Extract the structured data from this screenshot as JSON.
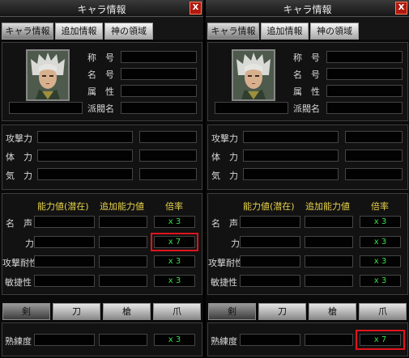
{
  "panels": [
    {
      "title": "キャラ情報",
      "close_label": "X",
      "tabs": [
        "キャラ情報",
        "追加情報",
        "神の領域"
      ],
      "info_labels": [
        "称　号",
        "名　号",
        "属　性",
        "派閥名"
      ],
      "stat_labels": [
        "攻撃力",
        "体　力",
        "気　力"
      ],
      "ability_headers": [
        "能力値(潜在)",
        "追加能力値",
        "倍率"
      ],
      "ability_rows": [
        {
          "label": "名　声",
          "mult": "x 3"
        },
        {
          "label": "力",
          "mult": "x 7"
        },
        {
          "label": "攻撃耐性",
          "mult": "x 3"
        },
        {
          "label": "敏捷性",
          "mult": "x 3"
        }
      ],
      "weapon_tabs": [
        "剣",
        "刀",
        "槍",
        "爪"
      ],
      "mastery_label": "熟練度",
      "mastery_mult": "x 3"
    },
    {
      "title": "キャラ情報",
      "close_label": "X",
      "tabs": [
        "キャラ情報",
        "追加情報",
        "神の領域"
      ],
      "info_labels": [
        "称　号",
        "名　号",
        "属　性",
        "派閥名"
      ],
      "stat_labels": [
        "攻撃力",
        "体　力",
        "気　力"
      ],
      "ability_headers": [
        "能力値(潜在)",
        "追加能力値",
        "倍率"
      ],
      "ability_rows": [
        {
          "label": "名　声",
          "mult": "x 3"
        },
        {
          "label": "力",
          "mult": "x 3"
        },
        {
          "label": "攻撃耐性",
          "mult": "x 3"
        },
        {
          "label": "敏捷性",
          "mult": "x 3"
        }
      ],
      "weapon_tabs": [
        "剣",
        "刀",
        "槍",
        "爪"
      ],
      "mastery_label": "熟練度",
      "mastery_mult": "x 7"
    }
  ],
  "colors": {
    "multiplier": "#39df47",
    "header": "#e7d24b",
    "highlight": "#e0141c"
  }
}
